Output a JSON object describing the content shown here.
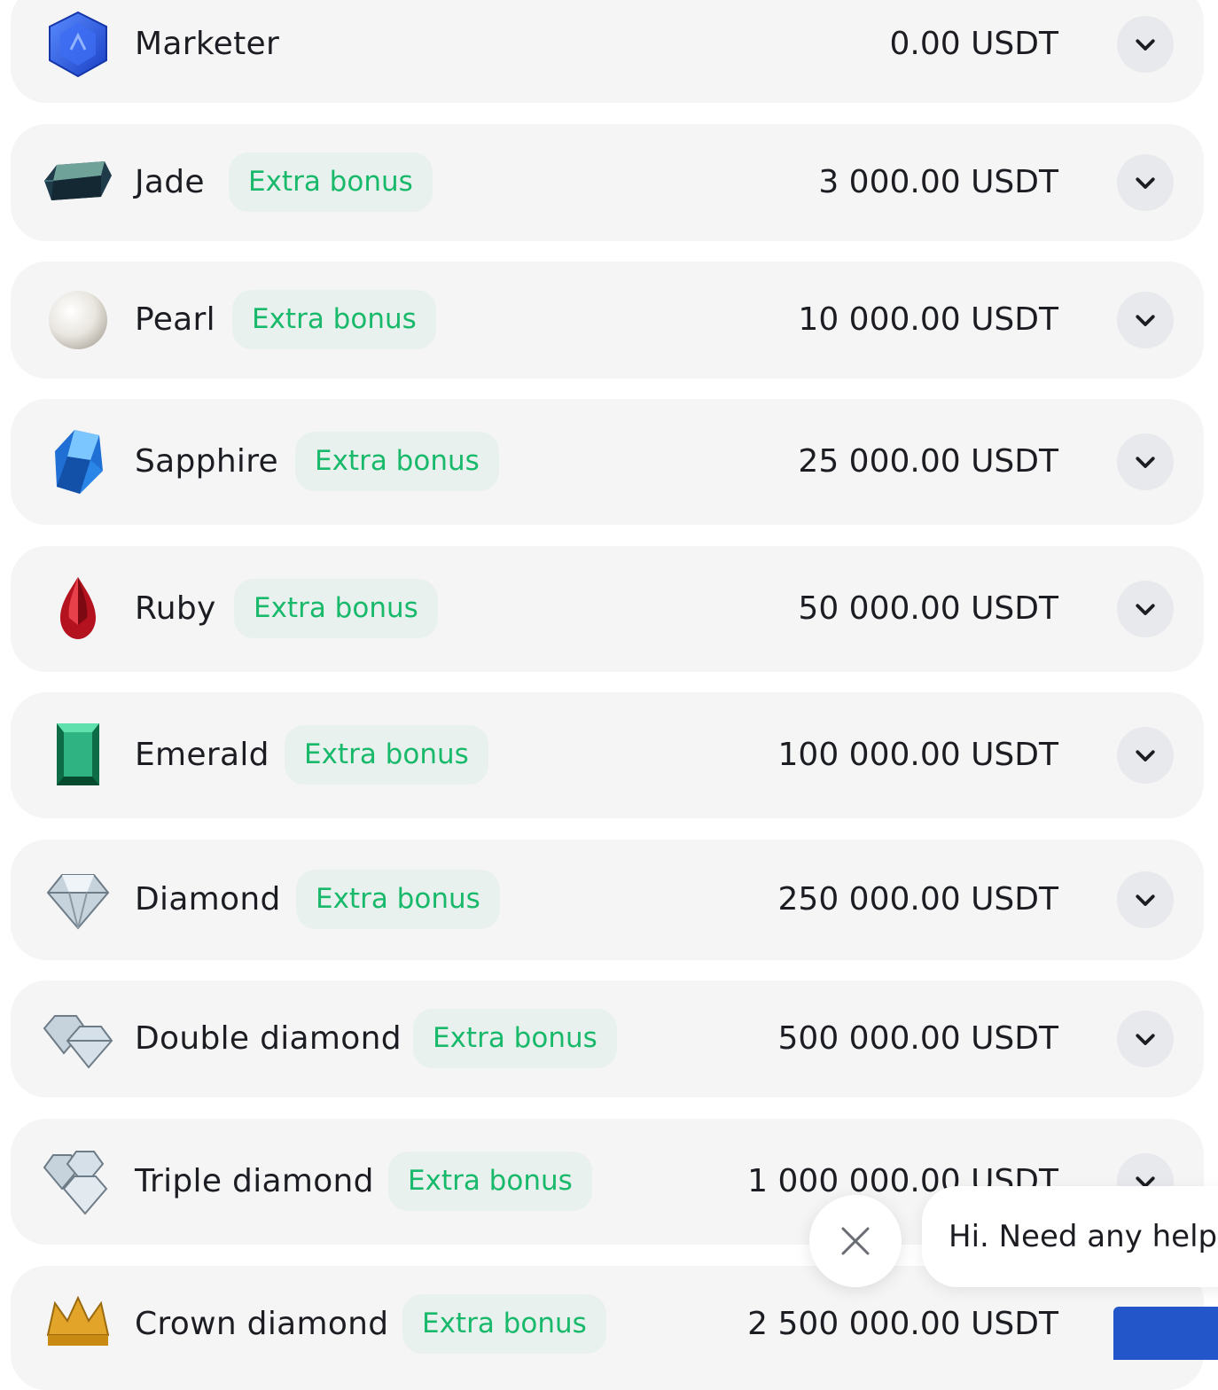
{
  "currency": "USDT",
  "tiers": [
    {
      "name": "Marketer",
      "badge": "",
      "amount": "0.00 USDT",
      "icon": "hexagon-gem-icon"
    },
    {
      "name": "Jade",
      "badge": "Extra bonus",
      "amount": "3 000.00 USDT",
      "icon": "jade-gem-icon"
    },
    {
      "name": "Pearl",
      "badge": "Extra bonus",
      "amount": "10 000.00 USDT",
      "icon": "pearl-icon"
    },
    {
      "name": "Sapphire",
      "badge": "Extra bonus",
      "amount": "25 000.00 USDT",
      "icon": "sapphire-icon"
    },
    {
      "name": "Ruby",
      "badge": "Extra bonus",
      "amount": "50 000.00 USDT",
      "icon": "ruby-icon"
    },
    {
      "name": "Emerald",
      "badge": "Extra bonus",
      "amount": "100 000.00 USDT",
      "icon": "emerald-icon"
    },
    {
      "name": "Diamond",
      "badge": "Extra bonus",
      "amount": "250 000.00 USDT",
      "icon": "diamond-icon"
    },
    {
      "name": "Double diamond",
      "badge": "Extra bonus",
      "amount": "500 000.00 USDT",
      "icon": "double-diamond-icon"
    },
    {
      "name": "Triple diamond",
      "badge": "Extra bonus",
      "amount": "1 000 000.00 USDT",
      "icon": "triple-diamond-icon"
    },
    {
      "name": "Crown diamond",
      "badge": "Extra bonus",
      "amount": "2 500 000.00 USDT",
      "icon": "crown-diamond-icon"
    }
  ],
  "chat": {
    "message": "Hi. Need any help?"
  },
  "colors": {
    "accent_green": "#18b96a",
    "badge_bg": "#e9f1ee",
    "row_bg": "#f5f5f6",
    "chat_button": "#2356c9"
  }
}
